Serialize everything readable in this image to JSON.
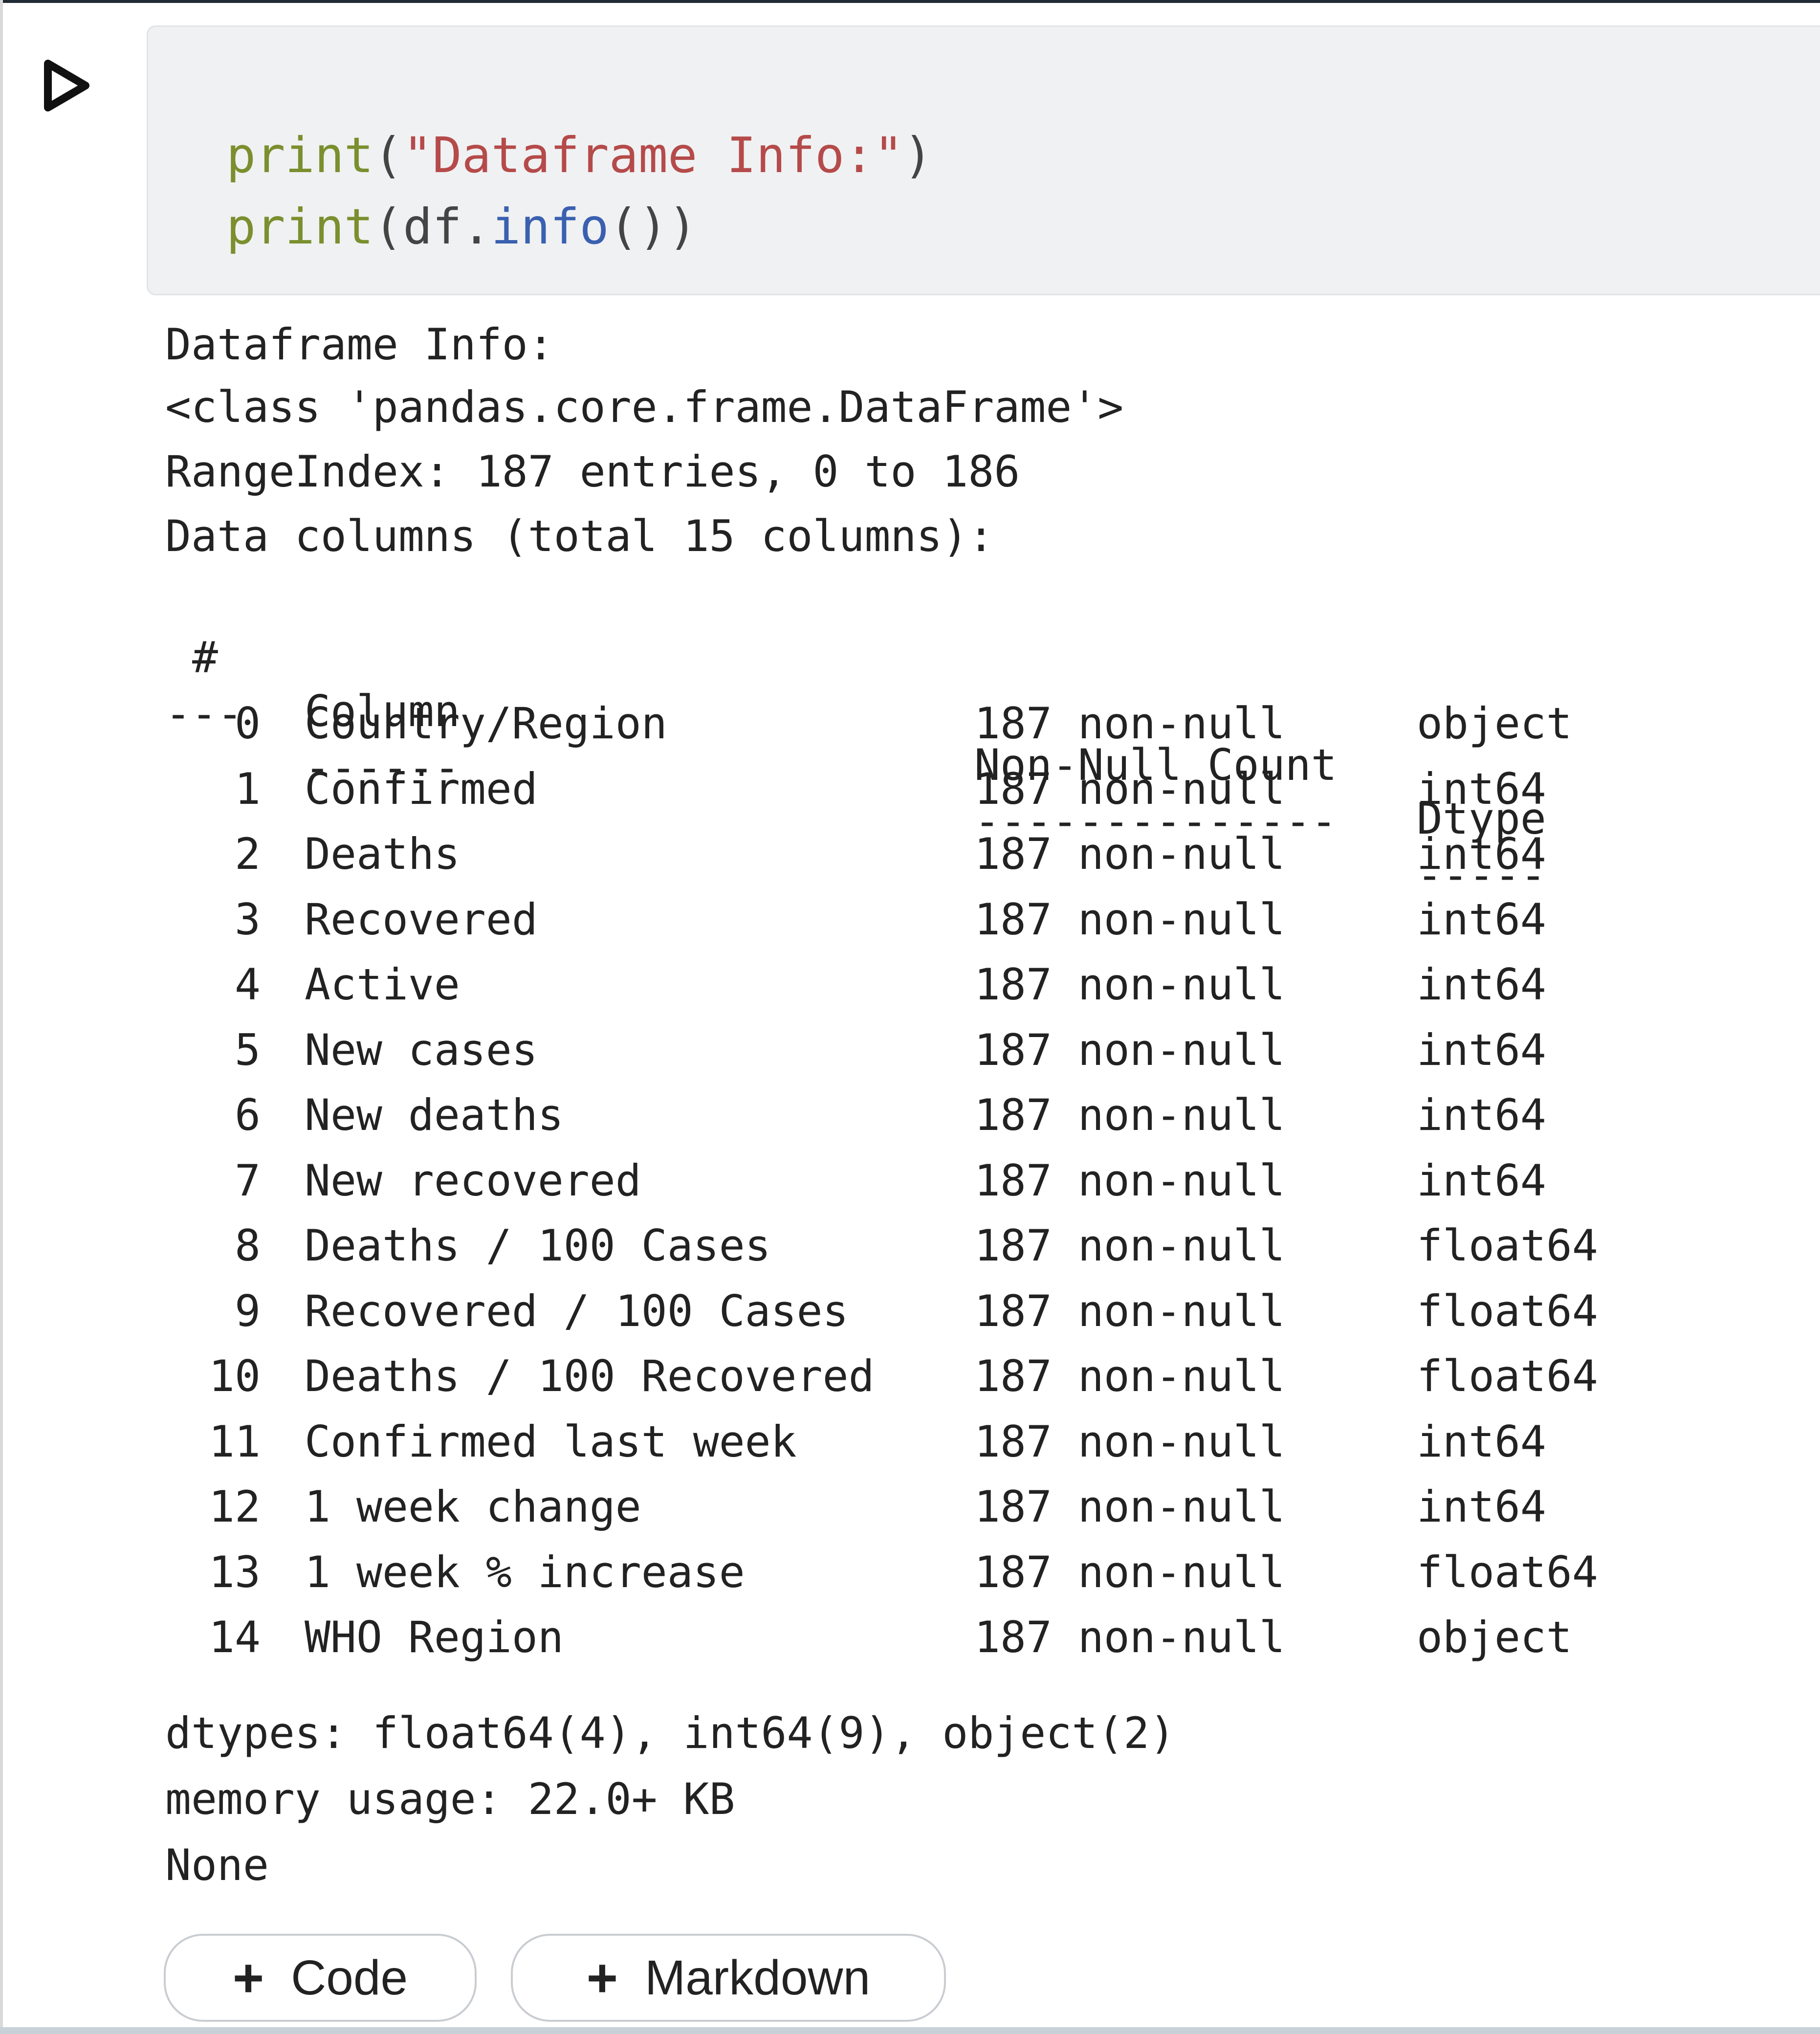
{
  "cell": {
    "run_icon": "play-icon",
    "code_lines": [
      {
        "builtin": "print",
        "open": "(",
        "arg": "\"Dataframe Info:\"",
        "close": ")"
      },
      {
        "builtin": "print",
        "open": "(",
        "obj": "df.",
        "method": "info",
        "call": "())",
        "close": ")"
      }
    ]
  },
  "output": {
    "header_lines": [
      "Dataframe Info:",
      "<class 'pandas.core.frame.DataFrame'>",
      "RangeIndex: 187 entries, 0 to 186",
      "Data columns (total 15 columns):"
    ],
    "table": {
      "headers": {
        "hash": "#",
        "column": "Column",
        "count": "Non-Null Count",
        "dtype": "Dtype"
      },
      "separators": {
        "hash": "---",
        "column": "------",
        "count": "--------------",
        "dtype": "-----"
      },
      "rows": [
        {
          "idx": "0",
          "name": "Country/Region",
          "count": "187 non-null",
          "dtype": "object"
        },
        {
          "idx": "1",
          "name": "Confirmed",
          "count": "187 non-null",
          "dtype": "int64"
        },
        {
          "idx": "2",
          "name": "Deaths",
          "count": "187 non-null",
          "dtype": "int64"
        },
        {
          "idx": "3",
          "name": "Recovered",
          "count": "187 non-null",
          "dtype": "int64"
        },
        {
          "idx": "4",
          "name": "Active",
          "count": "187 non-null",
          "dtype": "int64"
        },
        {
          "idx": "5",
          "name": "New cases",
          "count": "187 non-null",
          "dtype": "int64"
        },
        {
          "idx": "6",
          "name": "New deaths",
          "count": "187 non-null",
          "dtype": "int64"
        },
        {
          "idx": "7",
          "name": "New recovered",
          "count": "187 non-null",
          "dtype": "int64"
        },
        {
          "idx": "8",
          "name": "Deaths / 100 Cases",
          "count": "187 non-null",
          "dtype": "float64"
        },
        {
          "idx": "9",
          "name": "Recovered / 100 Cases",
          "count": "187 non-null",
          "dtype": "float64"
        },
        {
          "idx": "10",
          "name": "Deaths / 100 Recovered",
          "count": "187 non-null",
          "dtype": "float64"
        },
        {
          "idx": "11",
          "name": "Confirmed last week",
          "count": "187 non-null",
          "dtype": "int64"
        },
        {
          "idx": "12",
          "name": "1 week change",
          "count": "187 non-null",
          "dtype": "int64"
        },
        {
          "idx": "13",
          "name": "1 week % increase",
          "count": "187 non-null",
          "dtype": "float64"
        },
        {
          "idx": "14",
          "name": "WHO Region",
          "count": "187 non-null",
          "dtype": "object"
        }
      ]
    },
    "footer_lines": [
      "dtypes: float64(4), int64(9), object(2)",
      "memory usage: 22.0+ KB",
      "None"
    ]
  },
  "toolbar": {
    "add_code_label": "Code",
    "add_markdown_label": "Markdown",
    "plus_symbol": "+"
  }
}
